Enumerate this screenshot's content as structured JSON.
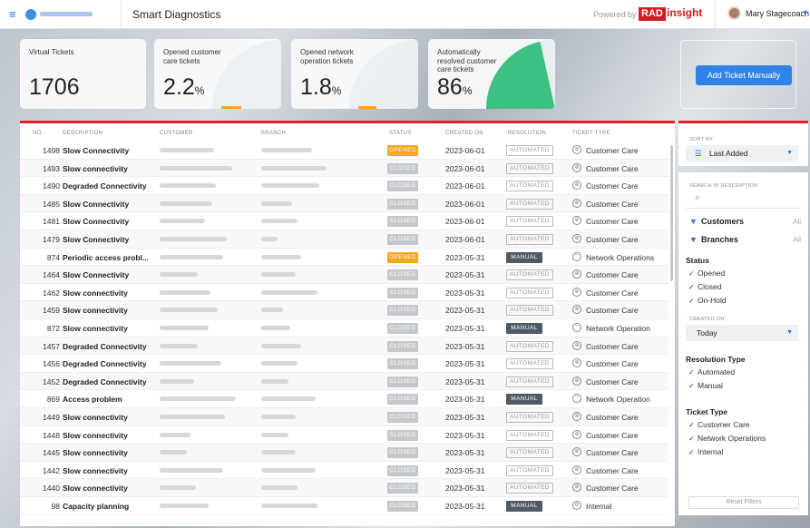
{
  "header": {
    "app_title": "Smart Diagnostics",
    "powered_by": "Powered by",
    "rad_label": "RAD",
    "insight_label": "insight",
    "user_name": "Mary Stagecoach"
  },
  "cards": [
    {
      "label": "Virtual Tickets",
      "value": "1706",
      "unit": ""
    },
    {
      "label": "Opened customer\ncare tickets",
      "value": "2.2",
      "unit": "%",
      "gauge": 0.022
    },
    {
      "label": "Opened network\noperation tickets",
      "value": "1.8",
      "unit": "%",
      "gauge": 0.018
    },
    {
      "label": "Automatically\nresolved customer\ncare tickets",
      "value": "86",
      "unit": "%",
      "gauge": 0.86
    }
  ],
  "add_button": "Add Ticket Manually",
  "columns": [
    "NO.",
    "DESCRIPTION",
    "CUSTOMER",
    "BRANCH",
    "STATUS",
    "CREATED ON",
    "RESOLUTION",
    "TICKET TYPE"
  ],
  "rows": [
    {
      "no": "1498",
      "desc": "Slow Connectivity",
      "status": "OPENED",
      "date": "2023-06-01",
      "res": "AUTOMATED",
      "type": "Customer Care"
    },
    {
      "no": "1493",
      "desc": "Slow connectivity",
      "status": "CLOSED",
      "date": "2023-06-01",
      "res": "AUTOMATED",
      "type": "Customer Care"
    },
    {
      "no": "1490",
      "desc": "Degraded Connectivity",
      "status": "CLOSED",
      "date": "2023-06-01",
      "res": "AUTOMATED",
      "type": "Customer Care"
    },
    {
      "no": "1485",
      "desc": "Slow Connectivity",
      "status": "CLOSED",
      "date": "2023-06-01",
      "res": "AUTOMATED",
      "type": "Customer Care"
    },
    {
      "no": "1481",
      "desc": "Slow Connectivity",
      "status": "CLOSED",
      "date": "2023-06-01",
      "res": "AUTOMATED",
      "type": "Customer Care"
    },
    {
      "no": "1479",
      "desc": "Slow Connectivity",
      "status": "CLOSED",
      "date": "2023-06-01",
      "res": "AUTOMATED",
      "type": "Customer Care"
    },
    {
      "no": "874",
      "desc": "Periodic access probl...",
      "status": "OPENED",
      "date": "2023-05-31",
      "res": "MANUAL",
      "type": "Network Operations"
    },
    {
      "no": "1464",
      "desc": "Slow Connectivity",
      "status": "CLOSED",
      "date": "2023-05-31",
      "res": "AUTOMATED",
      "type": "Customer Care"
    },
    {
      "no": "1462",
      "desc": "Slow connectivity",
      "status": "CLOSED",
      "date": "2023-05-31",
      "res": "AUTOMATED",
      "type": "Customer Care"
    },
    {
      "no": "1459",
      "desc": "Slow connectivity",
      "status": "CLOSED",
      "date": "2023-05-31",
      "res": "AUTOMATED",
      "type": "Customer Care"
    },
    {
      "no": "872",
      "desc": "Slow connectivity",
      "status": "CLOSED",
      "date": "2023-05-31",
      "res": "MANUAL",
      "type": "Network Operation"
    },
    {
      "no": "1457",
      "desc": "Degraded Connectivity",
      "status": "CLOSED",
      "date": "2023-05-31",
      "res": "AUTOMATED",
      "type": "Customer Care"
    },
    {
      "no": "1456",
      "desc": "Degraded Connectivity",
      "status": "CLOSED",
      "date": "2023-05-31",
      "res": "AUTOMATED",
      "type": "Customer Care"
    },
    {
      "no": "1452",
      "desc": "Degraded Connectivity",
      "status": "CLOSED",
      "date": "2023-05-31",
      "res": "AUTOMATED",
      "type": "Customer Care"
    },
    {
      "no": "869",
      "desc": "Access problem",
      "status": "CLOSED",
      "date": "2023-05-31",
      "res": "MANUAL",
      "type": "Network Operation"
    },
    {
      "no": "1449",
      "desc": "Slow connectivity",
      "status": "CLOSED",
      "date": "2023-05-31",
      "res": "AUTOMATED",
      "type": "Customer Care"
    },
    {
      "no": "1448",
      "desc": "Slow connectivity",
      "status": "CLOSED",
      "date": "2023-05-31",
      "res": "AUTOMATED",
      "type": "Customer Care"
    },
    {
      "no": "1445",
      "desc": "Slow connectivity",
      "status": "CLOSED",
      "date": "2023-05-31",
      "res": "AUTOMATED",
      "type": "Customer Care"
    },
    {
      "no": "1442",
      "desc": "Slow connectivity",
      "status": "CLOSED",
      "date": "2023-05-31",
      "res": "AUTOMATED",
      "type": "Customer Care"
    },
    {
      "no": "1440",
      "desc": "Slow connectivity",
      "status": "CLOSED",
      "date": "2023-05-31",
      "res": "AUTOMATED",
      "type": "Customer Care"
    },
    {
      "no": "98",
      "desc": "Capacity planning",
      "status": "CLOSED",
      "date": "2023-05-31",
      "res": "MANUAL",
      "type": "Internal"
    }
  ],
  "sort": {
    "label": "SORT BY",
    "value": "Last Added"
  },
  "filters": {
    "search_label": "SEARCH IN DESCRIPTION",
    "customers": "Customers",
    "branches": "Branches",
    "all": "All",
    "status_title": "Status",
    "status_items": [
      "Opened",
      "Closed",
      "On-Hold"
    ],
    "created_label": "CREATED ON",
    "created_value": "Today",
    "resolution_title": "Resolution Type",
    "resolution_items": [
      "Automated",
      "Manual"
    ],
    "type_title": "Ticket Type",
    "type_items": [
      "Customer Care",
      "Network Operations",
      "Internal"
    ],
    "reset": "Reset Filters"
  },
  "colors": {
    "accent": "#2e84e6",
    "brand_red": "#d71920",
    "opened": "#f5a623",
    "gauge_green": "#3cc182"
  }
}
